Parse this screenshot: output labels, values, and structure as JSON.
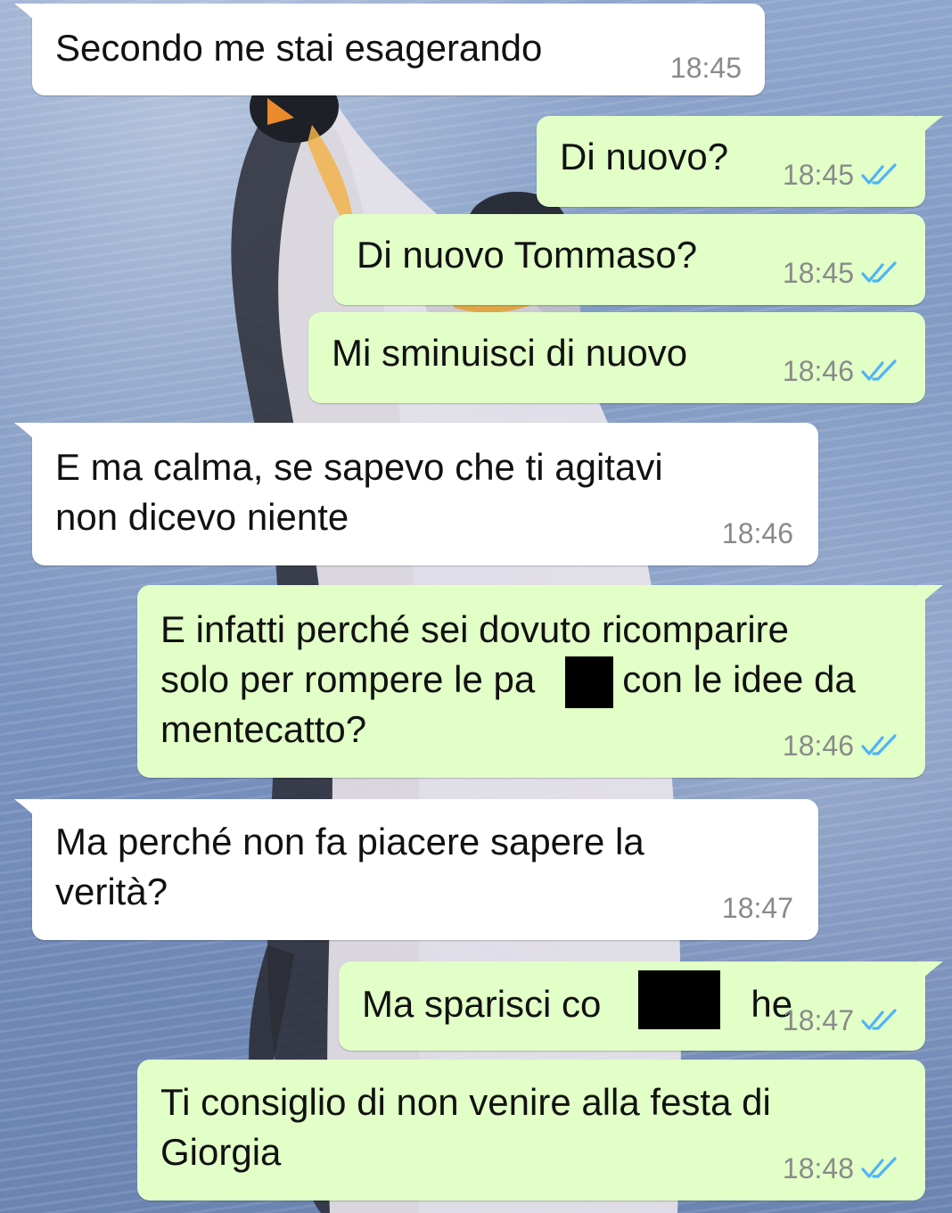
{
  "conversation": {
    "messages": [
      {
        "direction": "incoming",
        "lines": [
          "Secondo me stai esagerando"
        ],
        "time": "18:45"
      },
      {
        "direction": "outgoing",
        "lines": [
          "Di nuovo?"
        ],
        "time": "18:45",
        "status": "read-double-check"
      },
      {
        "direction": "outgoing",
        "lines": [
          "Di nuovo Tommaso?"
        ],
        "time": "18:45",
        "status": "read-double-check"
      },
      {
        "direction": "outgoing",
        "lines": [
          "Mi sminuisci di nuovo"
        ],
        "time": "18:46",
        "status": "read-double-check"
      },
      {
        "direction": "incoming",
        "lines": [
          "E ma calma, se sapevo che ti agitavi",
          "non dicevo niente"
        ],
        "time": "18:46"
      },
      {
        "direction": "outgoing",
        "lines": [
          "E infatti perché sei dovuto ricomparire",
          "solo per rompere le pa  e con le idee da",
          "mentecatto?"
        ],
        "time": "18:46",
        "status": "read-double-check",
        "redacted": true
      },
      {
        "direction": "incoming",
        "lines": [
          "Ma perché non fa piacere sapere la",
          "verità?"
        ],
        "time": "18:47"
      },
      {
        "direction": "outgoing",
        "lines": [
          "Ma sparisci co    he"
        ],
        "time": "18:47",
        "status": "read-double-check",
        "redacted": true
      },
      {
        "direction": "outgoing",
        "lines": [
          "Ti consiglio di non venire alla festa di",
          "Giorgia"
        ],
        "time": "18:48",
        "status": "read-double-check"
      }
    ]
  },
  "theme": {
    "incoming_bubble": "#ffffff",
    "outgoing_bubble": "#e2ffc8",
    "timestamp_color": "#8a8a8a",
    "read_tick_color": "#4fb3f6",
    "redaction_color": "#000000",
    "wallpaper": "penguin-on-ice"
  }
}
